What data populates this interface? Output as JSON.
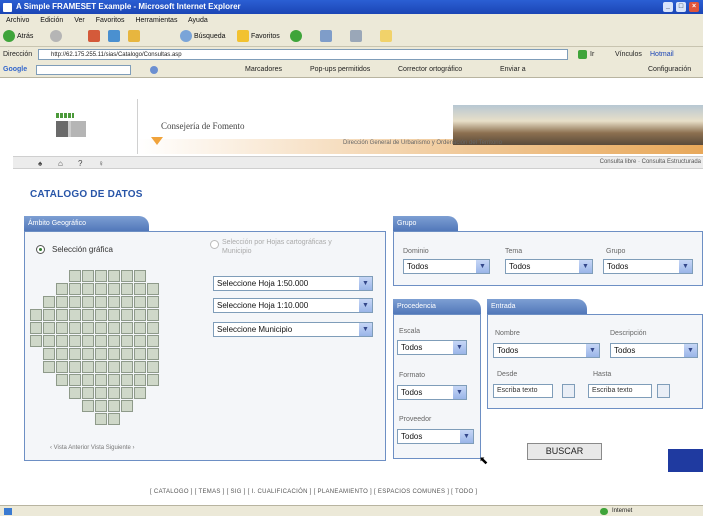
{
  "window": {
    "title": "A Simple FRAMESET Example - Microsoft Internet Explorer",
    "controls": [
      "_",
      "□",
      "×"
    ]
  },
  "menu": [
    "Archivo",
    "Edición",
    "Ver",
    "Favoritos",
    "Herramientas",
    "Ayuda"
  ],
  "toolbar": {
    "back_label": "Atrás",
    "search_label": "Búsqueda",
    "favorites_label": "Favoritos"
  },
  "address": {
    "label": "Dirección",
    "url": "http://62.175.255.11/sias/Catalogo/Consultas.asp",
    "go_label": "Ir",
    "links_label": "Vínculos",
    "links_item": "Hotmail",
    "config_label": "Configuración"
  },
  "google": {
    "label": "Google",
    "items": [
      "Marcadores",
      "Pop-ups permitidos",
      "Corrector ortográfico",
      "Enviar a"
    ]
  },
  "banner": {
    "title": "Consejería de Fomento",
    "subtitle": "Dirección General de Urbanismo y Ordenación del Territorio"
  },
  "navstrip": {
    "icons": [
      "home-icon",
      "back-icon",
      "help-icon",
      "search-icon"
    ],
    "glyphs": [
      "♠",
      "⌂",
      "?",
      "♀"
    ],
    "right_link": "Consulta libre · Consulta Estructurada"
  },
  "page_title": "CATALOGO DE DATOS",
  "ambito": {
    "tab": "Ámbito Geográfico",
    "radio_grafica": "Selección gráfica",
    "radio_hojas": "Selección por Hojas cartográficas y Municipio",
    "selects": [
      "Seleccione Hoja 1:50.000",
      "Seleccione Hoja 1:10.000",
      "Seleccione Municipio"
    ],
    "map_links": "‹ Vista Anterior   Vista Siguiente ›"
  },
  "grupo": {
    "tab": "Grupo",
    "fields": [
      {
        "label": "Dominio",
        "value": "Todos"
      },
      {
        "label": "Tema",
        "value": "Todos"
      },
      {
        "label": "Grupo",
        "value": "Todos"
      }
    ]
  },
  "procedencia": {
    "tab": "Procedencia",
    "fields": [
      {
        "label": "Escala",
        "value": "Todos"
      },
      {
        "label": "Formato",
        "value": "Todos"
      },
      {
        "label": "Proveedor",
        "value": "Todos"
      }
    ]
  },
  "entrada": {
    "tab": "Entrada",
    "nombre_label": "Nombre",
    "nombre_value": "Todos",
    "descripcion_label": "Descripción",
    "descripcion_value": "Todos",
    "desde_label": "Desde",
    "desde_value": "Escriba texto",
    "hasta_label": "Hasta",
    "hasta_value": "Escriba texto"
  },
  "buscar_label": "BUSCAR",
  "footer": "[ CATALOGO ]   [ TEMAS ]   [ SIG ]   [ I. CUALIFICACIÓN ]   [ PLANEAMIENTO ]   [ ESPACIOS COMUNES ]   [ TODO ]",
  "status": {
    "zone": "Internet"
  },
  "colors": {
    "accent": "#4f75b8",
    "title": "#2855a8",
    "panel_border": "#6d8fc4",
    "banner_orange": "#f0a33b"
  }
}
